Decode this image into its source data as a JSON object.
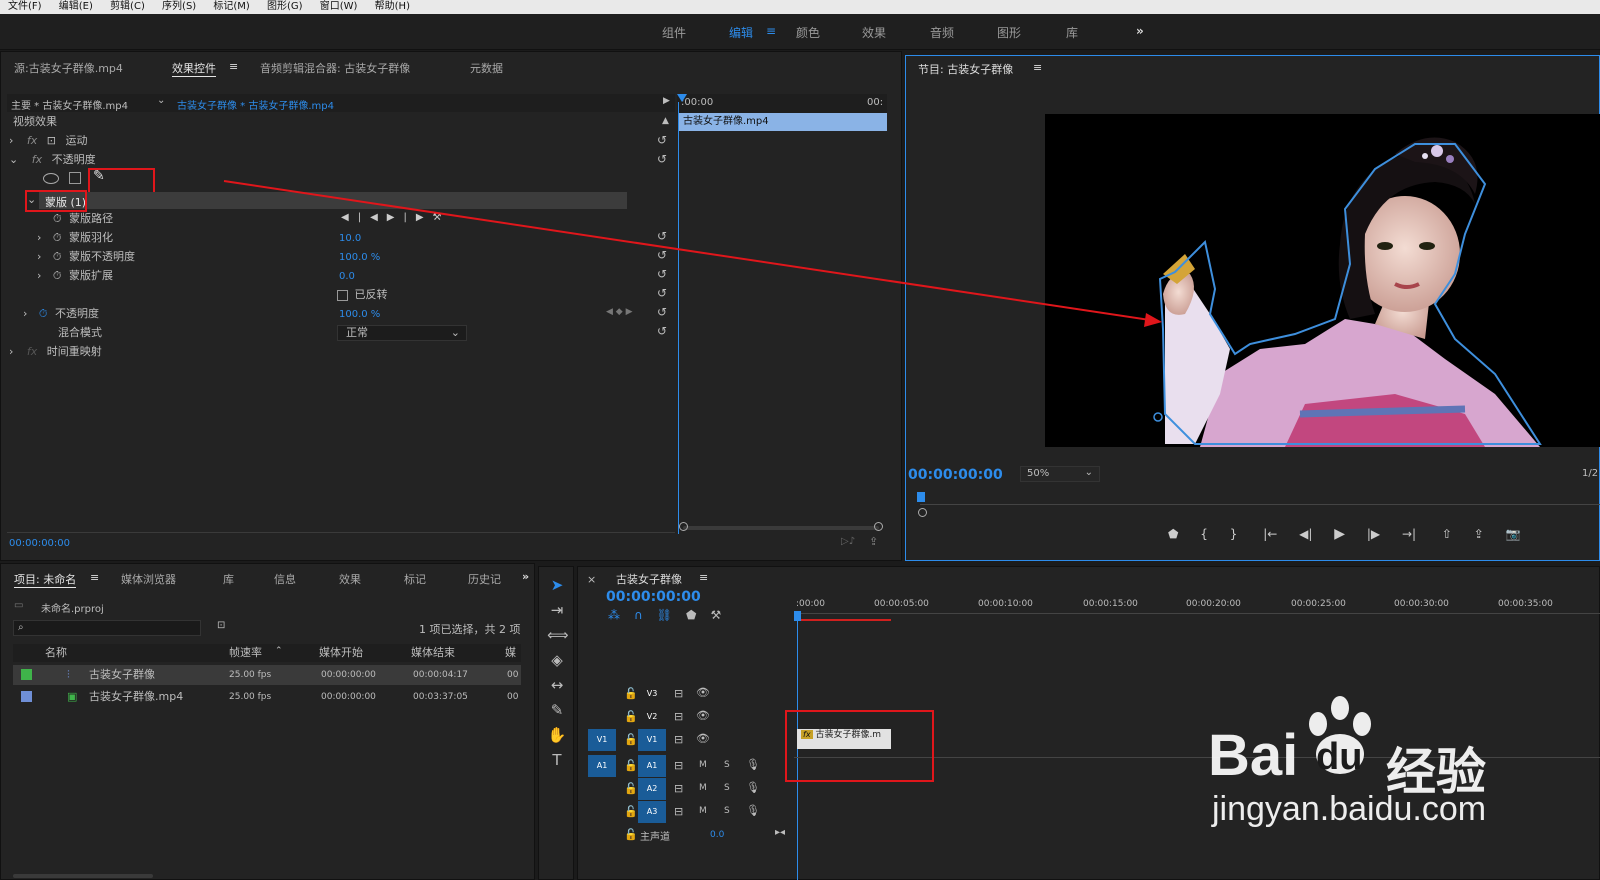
{
  "menu": [
    "文件(F)",
    "编辑(E)",
    "剪辑(C)",
    "序列(S)",
    "标记(M)",
    "图形(G)",
    "窗口(W)",
    "帮助(H)"
  ],
  "workspaces": [
    "组件",
    "编辑",
    "颜色",
    "效果",
    "音频",
    "图形",
    "库"
  ],
  "workspace_more": "»",
  "effects_panel": {
    "tabs": [
      "源:古装女子群像.mp4",
      "效果控件",
      "音频剪辑混合器: 古装女子群像",
      "元数据"
    ],
    "master": "主要 * 古装女子群像.mp4",
    "clip": "古装女子群像 * 古装女子群像.mp4",
    "ruler_start": ":00:00",
    "ruler_end": "00:",
    "timeline_clip": "古装女子群像.mp4",
    "section": "视频效果",
    "motion": "运动",
    "opacity": "不透明度",
    "mask": "蒙版 (1)",
    "mask_path": "蒙版路径",
    "mask_feather": "蒙版羽化",
    "mask_feather_val": "10.0",
    "mask_opacity": "蒙版不透明度",
    "mask_opacity_val": "100.0 %",
    "mask_expand": "蒙版扩展",
    "mask_expand_val": "0.0",
    "inverted": "已反转",
    "opacity2": "不透明度",
    "opacity2_val": "100.0 %",
    "blend": "混合模式",
    "blend_val": "正常",
    "time_remap": "时间重映射",
    "timecode": "00:00:00:00"
  },
  "program": {
    "title": "节目: 古装女子群像",
    "timecode": "00:00:00:00",
    "zoom": "50%",
    "fraction": "1/2"
  },
  "project": {
    "tabs": [
      "项目: 未命名",
      "媒体浏览器",
      "库",
      "信息",
      "效果",
      "标记",
      "历史记"
    ],
    "more": "»",
    "file": "未命名.prproj",
    "selection": "1 项已选择，共 2 项",
    "columns": [
      "名称",
      "帧速率",
      "媒体开始",
      "媒体结束",
      "媒"
    ],
    "items": [
      {
        "name": "古装女子群像",
        "fps": "25.00 fps",
        "start": "00:00:00:00",
        "end": "00:00:04:17",
        "extra": "00",
        "color": "#3fb44a"
      },
      {
        "name": "古装女子群像.mp4",
        "fps": "25.00 fps",
        "start": "00:00:00:00",
        "end": "00:03:37:05",
        "extra": "00",
        "color": "#6f8fd6"
      }
    ]
  },
  "timeline": {
    "title": "古装女子群像",
    "timecode": "00:00:00:00",
    "ruler": [
      ":00:00",
      "00:00:05:00",
      "00:00:10:00",
      "00:00:15:00",
      "00:00:20:00",
      "00:00:25:00",
      "00:00:30:00",
      "00:00:35:00"
    ],
    "tracks": [
      "V3",
      "V2",
      "V1",
      "A1",
      "A2",
      "A3"
    ],
    "source_v": "V1",
    "source_a": "A1",
    "clip": "古装女子群像.m",
    "master": "主声道",
    "master_val": "0.0",
    "mute": "M",
    "solo": "S"
  },
  "watermark": {
    "brand": "Bai",
    "brand2": "du",
    "cn": "经验",
    "url": "jingyan.baidu.com"
  },
  "colors": {
    "accent": "#2d8ceb",
    "annotation": "#e0161b",
    "track_on": "#1a5c98"
  }
}
